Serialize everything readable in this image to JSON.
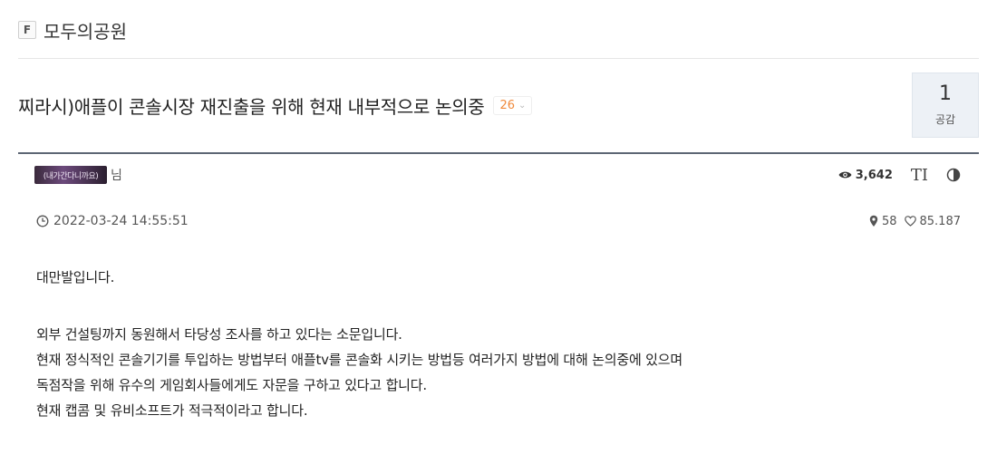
{
  "board": {
    "badge": "F",
    "name": "모두의공원"
  },
  "post": {
    "title": "찌라시)애플이 콘솔시장 재진출을 위해 현재 내부적으로 논의중",
    "comment_count": "26",
    "recommend": {
      "count": "1",
      "label": "공감"
    },
    "author": {
      "image_text": "(내가간다니까요)",
      "suffix": "님"
    },
    "views": "3,642",
    "font_button": "TI",
    "date": "2022-03-24 14:55:51",
    "location": "58",
    "likes": "85.187",
    "body": {
      "line1": "대만발입니다.",
      "line2": "외부 건설팅까지 동원해서 타당성 조사를 하고 있다는 소문입니다.",
      "line3": "현재 정식적인 콘솔기기를 투입하는 방법부터 애플tv를 콘솔화 시키는 방법등 여러가지 방법에 대해 논의중에 있으며",
      "line4": "독점작을 위해 유수의 게임회사들에게도 자문을 구하고 있다고 합니다.",
      "line5": "현재 캡콤 및 유비소프트가 적극적이라고 합니다."
    }
  },
  "icons": {
    "views": "eye-icon",
    "date": "clock-icon",
    "location": "pin-icon",
    "likes": "heart-icon",
    "contrast": "contrast-icon"
  },
  "colors": {
    "comment_count": "#f08a3c",
    "recommend_bg": "#edf1f6",
    "divider": "#5d6674"
  }
}
